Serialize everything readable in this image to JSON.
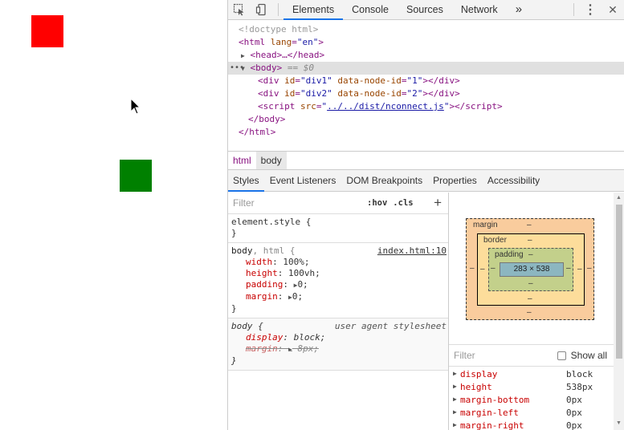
{
  "toolbar": {
    "inspect_icon": "inspect-element-icon",
    "device_icon": "device-toolbar-icon",
    "tabs": [
      "Elements",
      "Console",
      "Sources",
      "Network"
    ],
    "more_tabs": "»",
    "menu": "⋮",
    "close": "✕"
  },
  "dom": {
    "doctype": "<!doctype html>",
    "html_open": "<html",
    "lang_attr": "lang",
    "lang_val": "\"en\"",
    "head_collapsed": "<head>…</head>",
    "body_open": "<body>",
    "body_eq": "== $0",
    "div1": {
      "id": "\"div1\"",
      "node": "\"1\""
    },
    "div2": {
      "id": "\"div2\"",
      "node": "\"2\""
    },
    "script_src": "../../dist/nconnect.js",
    "body_close": "</body>",
    "html_close": "</html>"
  },
  "breadcrumbs": [
    "html",
    "body"
  ],
  "sidebar_tabs": [
    "Styles",
    "Event Listeners",
    "DOM Breakpoints",
    "Properties",
    "Accessibility"
  ],
  "styles": {
    "filter_placeholder": "Filter",
    "hov": ":hov",
    "cls": ".cls",
    "plus": "+",
    "element_style": "element.style {",
    "close_brace": "}",
    "rule1": {
      "selector_a": "body",
      "selector_b": ", html {",
      "source": "index.html:10",
      "props": [
        {
          "name": "width",
          "value": "100%;"
        },
        {
          "name": "height",
          "value": "100vh;"
        },
        {
          "name": "padding",
          "value": "0;"
        },
        {
          "name": "margin",
          "value": "0;"
        }
      ]
    },
    "rule2": {
      "selector": "body {",
      "source": "user agent stylesheet",
      "props": [
        {
          "name": "display",
          "value": "block;"
        },
        {
          "name": "margin",
          "value": "8px;"
        }
      ]
    }
  },
  "box_model": {
    "margin_label": "margin",
    "border_label": "border",
    "padding_label": "padding",
    "dash": "–",
    "content_size": "283 × 538"
  },
  "computed": {
    "filter_placeholder": "Filter",
    "show_all": "Show all",
    "rows": [
      {
        "name": "display",
        "value": "block"
      },
      {
        "name": "height",
        "value": "538px"
      },
      {
        "name": "margin-bottom",
        "value": "0px"
      },
      {
        "name": "margin-left",
        "value": "0px"
      },
      {
        "name": "margin-right",
        "value": "0px"
      }
    ]
  },
  "colors": {
    "div1": "#ff0000",
    "div2": "#008000",
    "accent": "#1a73e8"
  }
}
